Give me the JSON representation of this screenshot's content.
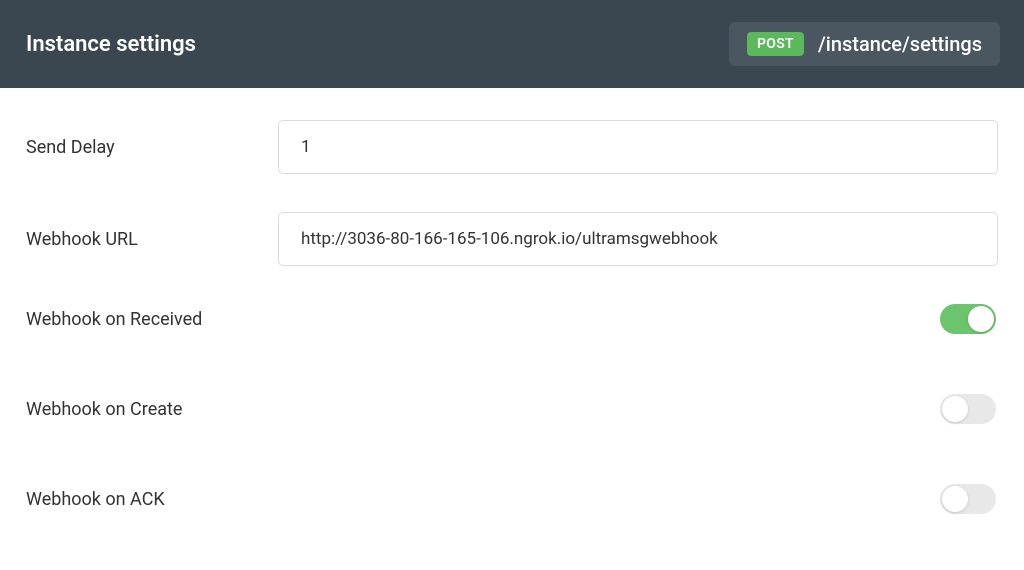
{
  "header": {
    "title": "Instance settings",
    "method": "POST",
    "path": "/instance/settings"
  },
  "form": {
    "sendDelay": {
      "label": "Send Delay",
      "value": "1"
    },
    "webhookUrl": {
      "label": "Webhook URL",
      "value": "http://3036-80-166-165-106.ngrok.io/ultramsgwebhook"
    },
    "webhookReceived": {
      "label": "Webhook on Received",
      "enabled": true
    },
    "webhookCreate": {
      "label": "Webhook on Create",
      "enabled": false
    },
    "webhookAck": {
      "label": "Webhook on ACK",
      "enabled": false
    }
  }
}
